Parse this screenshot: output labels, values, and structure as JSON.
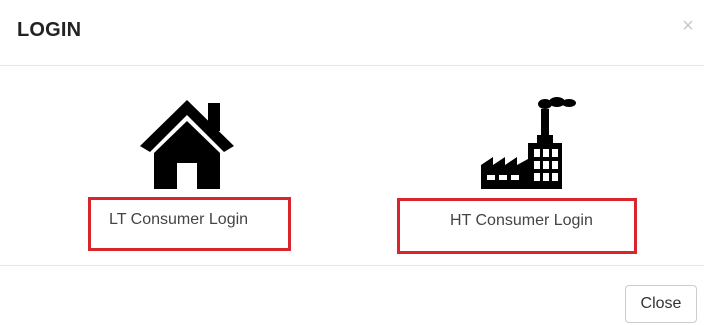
{
  "dialog": {
    "title": "LOGIN",
    "close_symbol": "×",
    "close_icon": "close-icon"
  },
  "options": [
    {
      "label": "LT Consumer Login",
      "icon": "house-icon"
    },
    {
      "label": "HT Consumer Login",
      "icon": "factory-icon"
    }
  ],
  "footer": {
    "close_label": "Close"
  },
  "colors": {
    "highlight_border": "#d9262d",
    "icon_fill": "#000000"
  }
}
